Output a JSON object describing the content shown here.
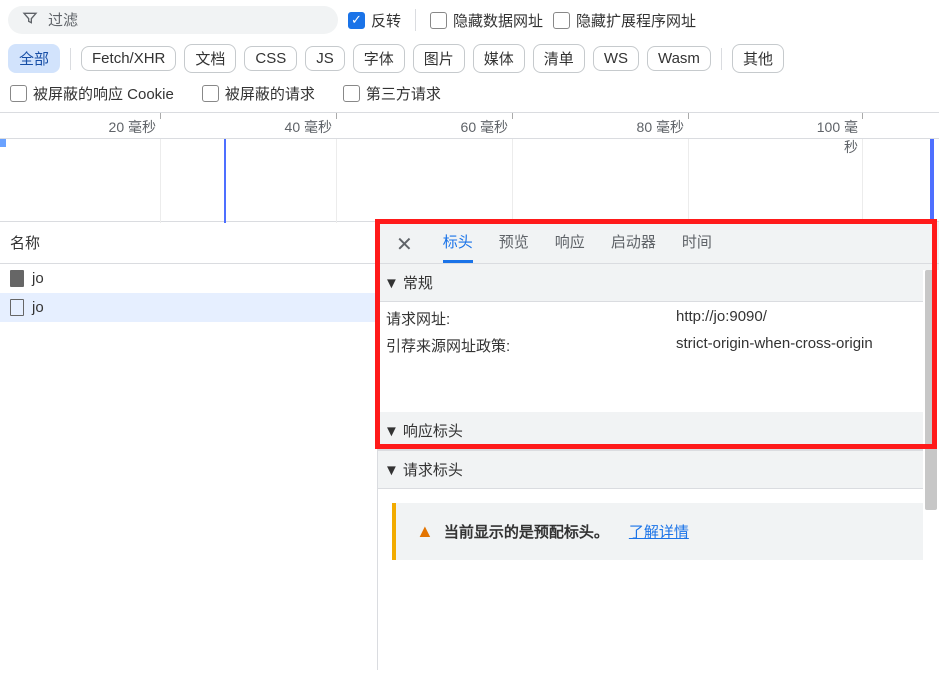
{
  "filter": {
    "placeholder": "过滤"
  },
  "checks1": {
    "invert": "反转",
    "hideData": "隐藏数据网址",
    "hideExt": "隐藏扩展程序网址"
  },
  "types": [
    "全部",
    "Fetch/XHR",
    "文档",
    "CSS",
    "JS",
    "字体",
    "图片",
    "媒体",
    "清单",
    "WS",
    "Wasm",
    "其他"
  ],
  "checks2": {
    "blockedCookies": "被屏蔽的响应 Cookie",
    "blockedReq": "被屏蔽的请求",
    "thirdParty": "第三方请求"
  },
  "timeline": {
    "ticks": [
      "20 毫秒",
      "40 毫秒",
      "60 毫秒",
      "80 毫秒",
      "100 毫秒"
    ]
  },
  "leftPane": {
    "header": "名称",
    "rows": [
      "jo",
      "jo"
    ]
  },
  "detail": {
    "tabs": [
      "标头",
      "预览",
      "响应",
      "启动器",
      "时间"
    ],
    "sections": {
      "general": "常规",
      "respHeaders": "响应标头",
      "reqHeaders": "请求标头"
    },
    "general": {
      "requestUrlLabel": "请求网址:",
      "requestUrlValue": "http://jo:9090/",
      "referrerLabel": "引荐来源网址政策:",
      "referrerValue": "strict-origin-when-cross-origin"
    },
    "warning": {
      "text": "当前显示的是预配标头。",
      "link": "了解详情"
    }
  }
}
